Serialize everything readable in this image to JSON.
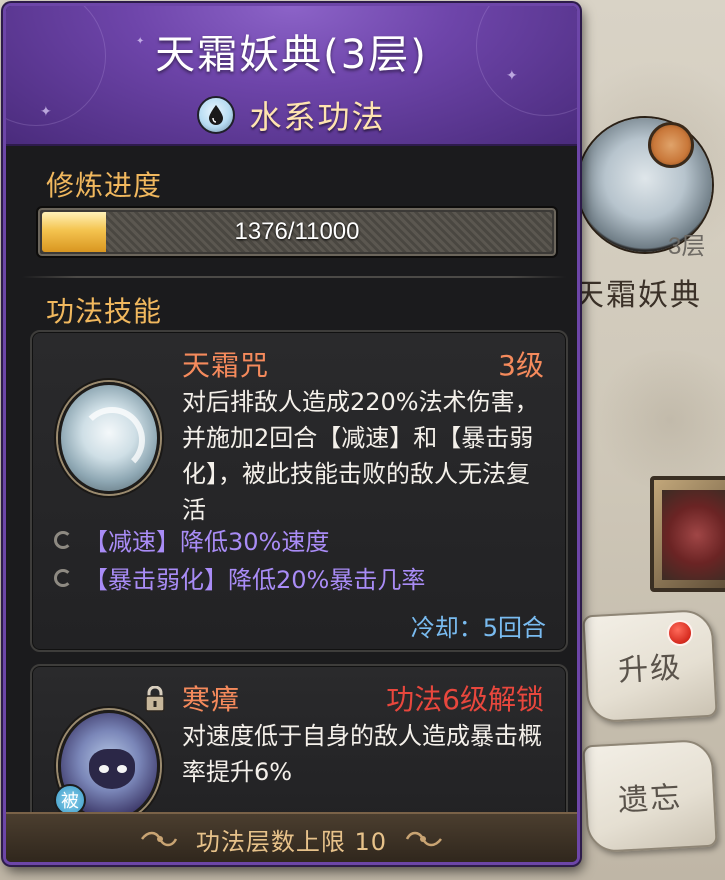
{
  "panel": {
    "title": "天霜妖典(3层)",
    "element": "水系功法",
    "progress": {
      "label": "修炼进度",
      "current": 1376,
      "total": 11000,
      "text": "1376/11000"
    },
    "skills_label": "功法技能",
    "skills": [
      {
        "name": "天霜咒",
        "level": "3级",
        "description": "对后排敌人造成220%法术伤害，并施加2回合【减速】和【暴击弱化】，被此技能击败的敌人无法复活",
        "effects": [
          "【减速】降低30%速度",
          "【暴击弱化】降低20%暴击几率"
        ],
        "cooldown": "冷却：5回合"
      },
      {
        "name": "寒瘴",
        "unlock": "功法6级解锁",
        "description": "对速度低于自身的敌人造成暴击概率提升6%",
        "badge": "被"
      }
    ],
    "footer": "功法层数上限 10"
  },
  "side": {
    "layer_text": "3层",
    "name_text": "天霜妖典",
    "upgrade_button": "升级",
    "forget_button": "遗忘"
  },
  "colors": {
    "panel_border": "#6d46a8",
    "header": "#6e45aa",
    "section_title": "#f1b85e",
    "skill_name": "#f58a5c",
    "unlock_text": "#e8473d",
    "effect_text": "#a98cf6",
    "cooldown_text": "#79bbf0",
    "progress_fill": "#f4c450"
  },
  "icons": [
    "water-drop-icon",
    "skill-frost-icon",
    "skill-miasma-icon",
    "lock-icon",
    "swirl-icon",
    "footer-ornament-icon"
  ]
}
